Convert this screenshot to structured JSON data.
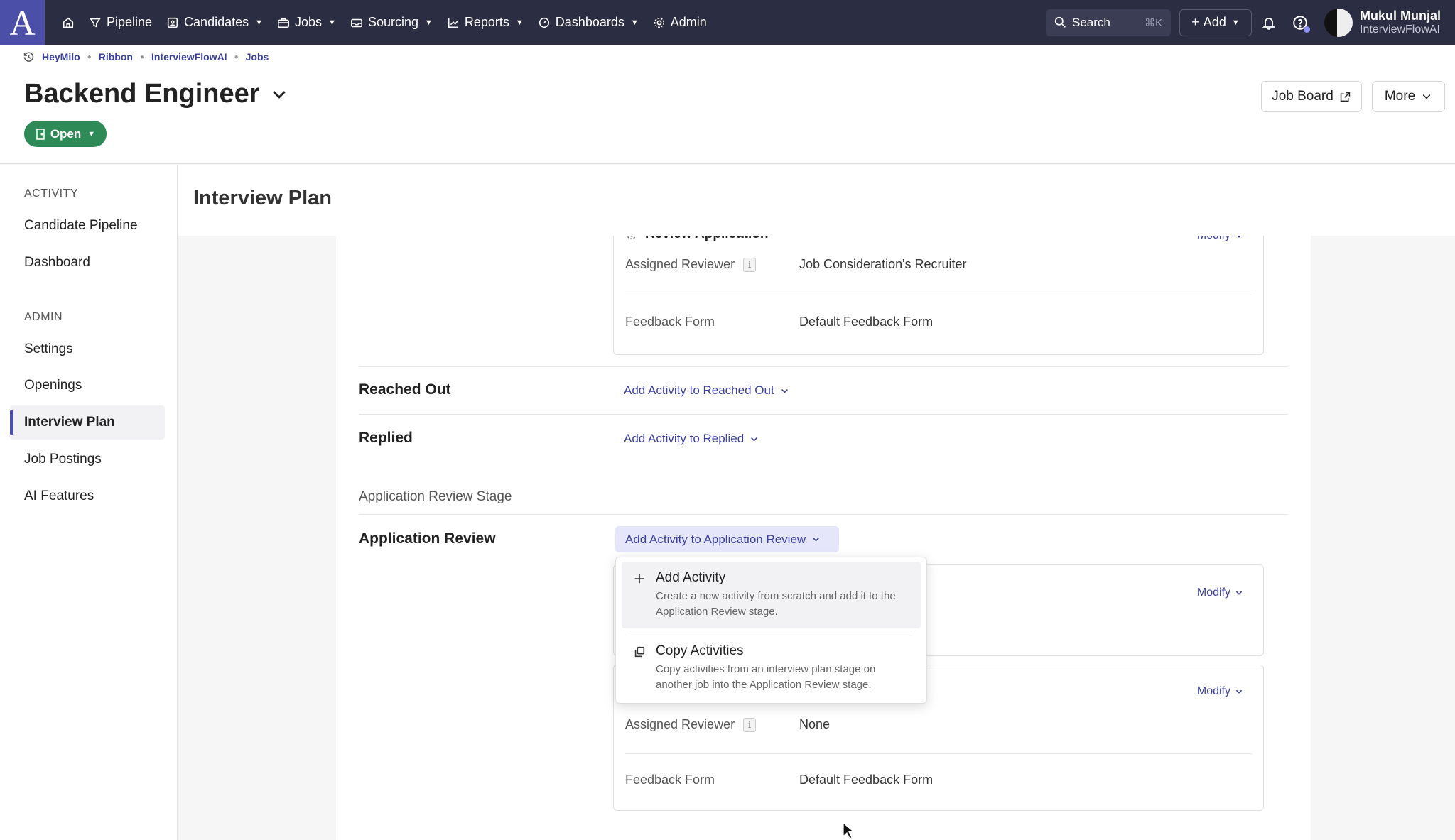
{
  "nav": {
    "logo": "A",
    "items": [
      {
        "label": "Pipeline",
        "icon": "filter-icon",
        "caret": false
      },
      {
        "label": "Candidates",
        "icon": "id-card-icon",
        "caret": true
      },
      {
        "label": "Jobs",
        "icon": "briefcase-icon",
        "caret": true
      },
      {
        "label": "Sourcing",
        "icon": "inbox-icon",
        "caret": true
      },
      {
        "label": "Reports",
        "icon": "chart-icon",
        "caret": true
      },
      {
        "label": "Dashboards",
        "icon": "gauge-icon",
        "caret": true
      },
      {
        "label": "Admin",
        "icon": "gear-icon",
        "caret": false
      }
    ],
    "search": {
      "label": "Search",
      "shortcut": "⌘K"
    },
    "add_label": "Add",
    "user": {
      "name": "Mukul Munjal",
      "org": "InterviewFlowAI"
    }
  },
  "breadcrumb": [
    "HeyMilo",
    "Ribbon",
    "InterviewFlowAI",
    "Jobs"
  ],
  "header": {
    "title": "Backend Engineer",
    "status": "Open",
    "job_board_label": "Job Board",
    "more_label": "More"
  },
  "sidebar": {
    "activity_heading": "ACTIVITY",
    "activity_items": [
      "Candidate Pipeline",
      "Dashboard"
    ],
    "admin_heading": "ADMIN",
    "admin_items": [
      "Settings",
      "Openings",
      "Interview Plan",
      "Job Postings",
      "AI Features"
    ],
    "active_item": "Interview Plan"
  },
  "page": {
    "title": "Interview Plan",
    "top_card": {
      "activity_name": "Review Application",
      "modify_label": "Modify",
      "reviewer_label": "Assigned Reviewer",
      "reviewer_value": "Job Consideration's Recruiter",
      "form_label": "Feedback Form",
      "form_value": "Default Feedback Form"
    },
    "stages": [
      {
        "name": "Reached Out",
        "add_label": "Add Activity to Reached Out"
      },
      {
        "name": "Replied",
        "add_label": "Add Activity to Replied"
      }
    ],
    "section_label": "Application Review Stage",
    "review_stage": {
      "name": "Application Review",
      "add_label": "Add Activity to Application Review"
    },
    "card2": {
      "modify_label": "Modify"
    },
    "card3": {
      "modify_label": "Modify",
      "reviewer_label": "Assigned Reviewer",
      "reviewer_value": "None",
      "form_label": "Feedback Form",
      "form_value": "Default Feedback Form"
    }
  },
  "dropdown": {
    "items": [
      {
        "title": "Add Activity",
        "desc": "Create a new activity from scratch and add it to the Application Review stage.",
        "icon": "plus-icon"
      },
      {
        "title": "Copy Activities",
        "desc": "Copy activities from an interview plan stage on another job into the Application Review stage.",
        "icon": "copy-icon"
      }
    ]
  },
  "colors": {
    "nav_bg": "#2b2d42",
    "accent": "#4b4fa8",
    "link": "#3a3f9c",
    "status_open": "#2e8b57"
  }
}
